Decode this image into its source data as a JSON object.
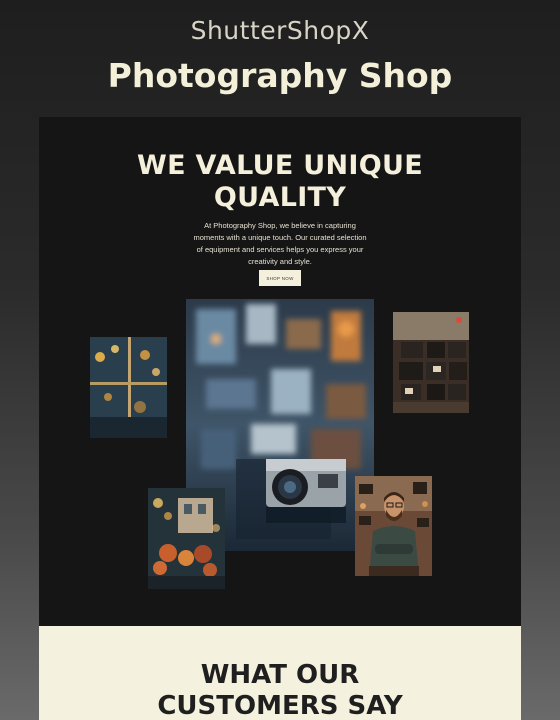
{
  "header": {
    "brand": "ShutterShopX",
    "title": "Photography Shop"
  },
  "hero": {
    "heading_line1": "WE VALUE UNIQUE",
    "heading_line2": "QUALITY",
    "description": "At Photography Shop, we believe in capturing moments with a unique touch. Our curated selection of equipment and services helps you express your creativity and style.",
    "button_label": "SHOP NOW"
  },
  "gallery": {
    "images": [
      {
        "name": "camera-shop-window-photo"
      },
      {
        "name": "bokeh-lights-photo"
      },
      {
        "name": "vintage-cameras-shelf-photo"
      },
      {
        "name": "street-market-photo"
      },
      {
        "name": "shopkeeper-portrait-photo"
      }
    ]
  },
  "testimonials": {
    "heading_line1": "WHAT OUR",
    "heading_line2": "CUSTOMERS SAY"
  },
  "colors": {
    "page_background": "#151515",
    "accent_cream": "#f5f0dc",
    "testimonials_background": "#f4f1de"
  }
}
